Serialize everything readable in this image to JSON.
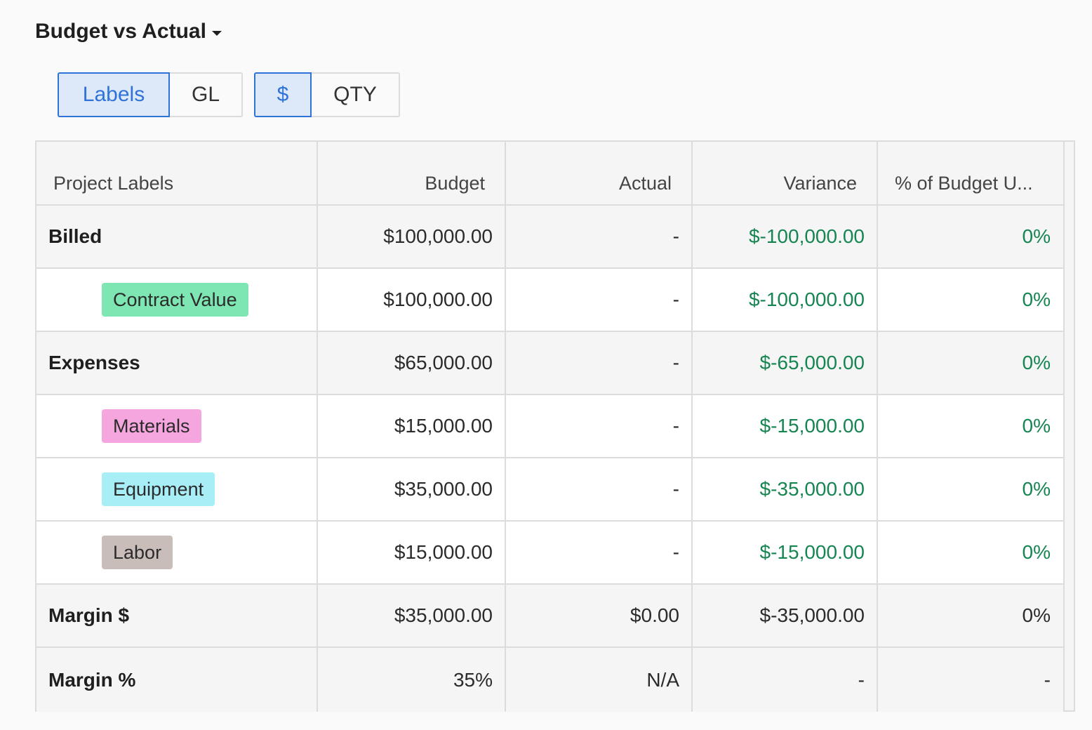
{
  "title": "Budget vs Actual",
  "toggles": {
    "view": [
      {
        "label": "Labels",
        "active": true
      },
      {
        "label": "GL",
        "active": false
      }
    ],
    "unit": [
      {
        "label": "$",
        "active": true
      },
      {
        "label": "QTY",
        "active": false
      }
    ]
  },
  "table": {
    "headers": [
      "Project Labels",
      "Budget",
      "Actual",
      "Variance",
      "% of Budget U..."
    ],
    "rows": [
      {
        "label": "Billed",
        "budget": "$100,000.00",
        "actual": "-",
        "variance": "$-100,000.00",
        "pct": "0%"
      },
      {
        "label": "Contract Value",
        "budget": "$100,000.00",
        "actual": "-",
        "variance": "$-100,000.00",
        "pct": "0%"
      },
      {
        "label": "Expenses",
        "budget": "$65,000.00",
        "actual": "-",
        "variance": "$-65,000.00",
        "pct": "0%"
      },
      {
        "label": "Materials",
        "budget": "$15,000.00",
        "actual": "-",
        "variance": "$-15,000.00",
        "pct": "0%"
      },
      {
        "label": "Equipment",
        "budget": "$35,000.00",
        "actual": "-",
        "variance": "$-35,000.00",
        "pct": "0%"
      },
      {
        "label": "Labor",
        "budget": "$15,000.00",
        "actual": "-",
        "variance": "$-15,000.00",
        "pct": "0%"
      },
      {
        "label": "Margin $",
        "budget": "$35,000.00",
        "actual": "$0.00",
        "variance": "$-35,000.00",
        "pct": "0%"
      },
      {
        "label": "Margin %",
        "budget": "35%",
        "actual": "N/A",
        "variance": "-",
        "pct": "-"
      }
    ]
  },
  "colors": {
    "accent": "#2f73d9",
    "positive_text": "#178552",
    "tag_contract_value": "#7de6b2",
    "tag_materials": "#f6a6df",
    "tag_equipment": "#a8eef6",
    "tag_labor": "#c9bdb9"
  },
  "icons": {
    "title_dropdown": "caret-down-icon"
  }
}
